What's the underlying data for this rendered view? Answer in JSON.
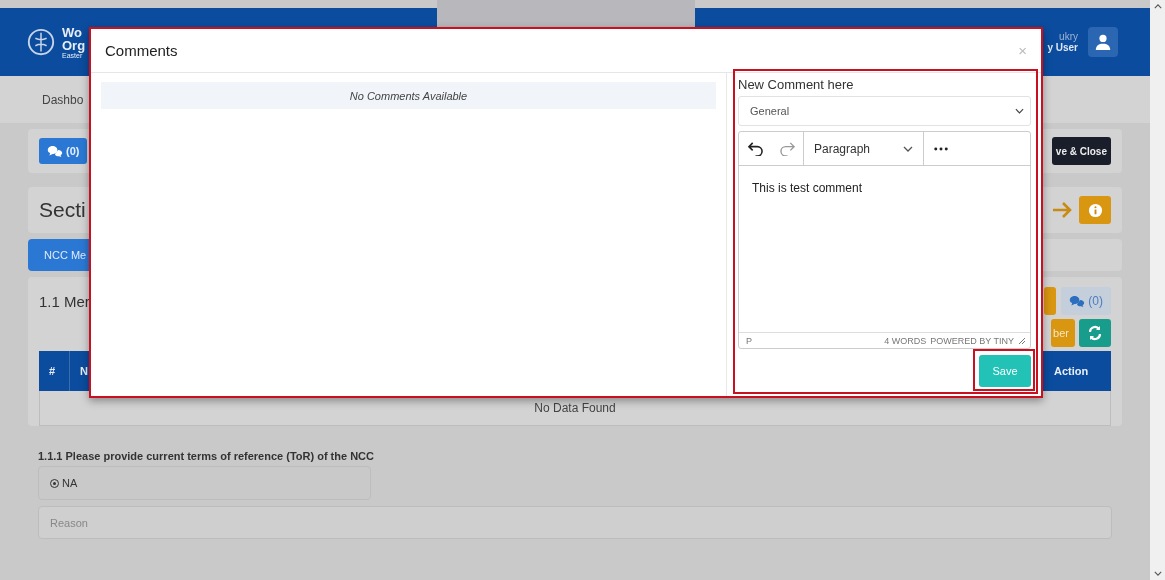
{
  "header": {
    "logo_lines": [
      "Wo",
      "Org"
    ],
    "logo_sub": "Easter",
    "user_name": "ukry",
    "user_role": "y User"
  },
  "nav": {
    "items": [
      "Dashbo"
    ]
  },
  "toolbar": {
    "comments_button": "(0)",
    "save_close_button": "ve & Close"
  },
  "section": {
    "title": "Secti"
  },
  "tabs": [
    {
      "label": "NCC Me",
      "selected": true
    }
  ],
  "subsection": {
    "title": "1.1 Mer",
    "comments_button": "(0)",
    "add_button": "ber",
    "table": {
      "columns": [
        "#",
        "N",
        "Action"
      ],
      "empty_text": "No Data Found"
    }
  },
  "questions": [
    {
      "label": "1.1.1 Please provide current terms of reference (ToR) of the NCC",
      "options": [
        {
          "label": "NA",
          "selected": true
        }
      ],
      "reason_placeholder": "Reason"
    }
  ],
  "modal": {
    "title": "Comments",
    "close": "×",
    "empty_text": "No Comments Available",
    "form_title": "New Comment here",
    "category": "General",
    "editor": {
      "block_format": "Paragraph",
      "content": "This is test comment",
      "path": "P",
      "word_count": "4 WORDS",
      "branding": "POWERED BY TINY"
    },
    "save_button": "Save"
  }
}
